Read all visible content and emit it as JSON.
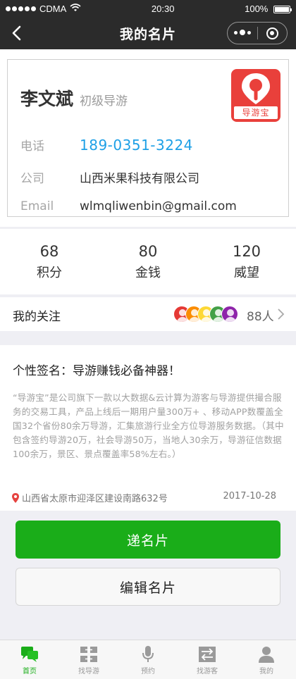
{
  "status_bar": {
    "carrier": "CDMA",
    "time": "20:30",
    "battery": "100%"
  },
  "nav": {
    "title": "我的名片"
  },
  "card": {
    "name": "李文斌",
    "level": "初级导游",
    "logo_text": "导游宝",
    "phone_label": "电话",
    "phone": "189-0351-3224",
    "company_label": "公司",
    "company": "山西米果科技有限公司",
    "email_label": "Email",
    "email": "wlmqliwenbin@gmail.com"
  },
  "stats": [
    {
      "value": "68",
      "label": "积分"
    },
    {
      "value": "80",
      "label": "金钱"
    },
    {
      "value": "120",
      "label": "威望"
    }
  ],
  "follow": {
    "label": "我的关注",
    "count": "88人",
    "avatar_colors": [
      "#e53935",
      "#fb8c00",
      "#fdd835",
      "#43a047",
      "#8e24aa"
    ]
  },
  "signature": {
    "title": "个性签名：导游赚钱必备神器！",
    "body": "“导游宝”是公司旗下一款以大数据&云计算为游客与导游提供撮合服务的交易工具，产品上线后一期用户量300万+ 、移动APP数覆盖全国32个省份80余万导游，汇集旅游行业全方位导游服务数据。（其中包含签约导游20万，社会导游50万，当地人30余万，导游征信数据100余万，景区、景点覆盖率58%左右。）",
    "address": "山西省太原市迎泽区建设南路632号",
    "date": "2017-10-28"
  },
  "buttons": {
    "send": "递名片",
    "edit": "编辑名片"
  },
  "tabs": [
    {
      "label": "首页",
      "icon": "chat-bubbles-icon",
      "active": true
    },
    {
      "label": "找导游",
      "icon": "swap-grid-icon",
      "active": false
    },
    {
      "label": "预约",
      "icon": "microphone-icon",
      "active": false
    },
    {
      "label": "找游客",
      "icon": "swap-arrows-icon",
      "active": false
    },
    {
      "label": "我的",
      "icon": "user-icon",
      "active": false
    }
  ],
  "colors": {
    "accent": "#1aad19",
    "phone": "#1ea0e6",
    "logo": "#e9403b",
    "nav_bg": "#2b2b2b"
  }
}
